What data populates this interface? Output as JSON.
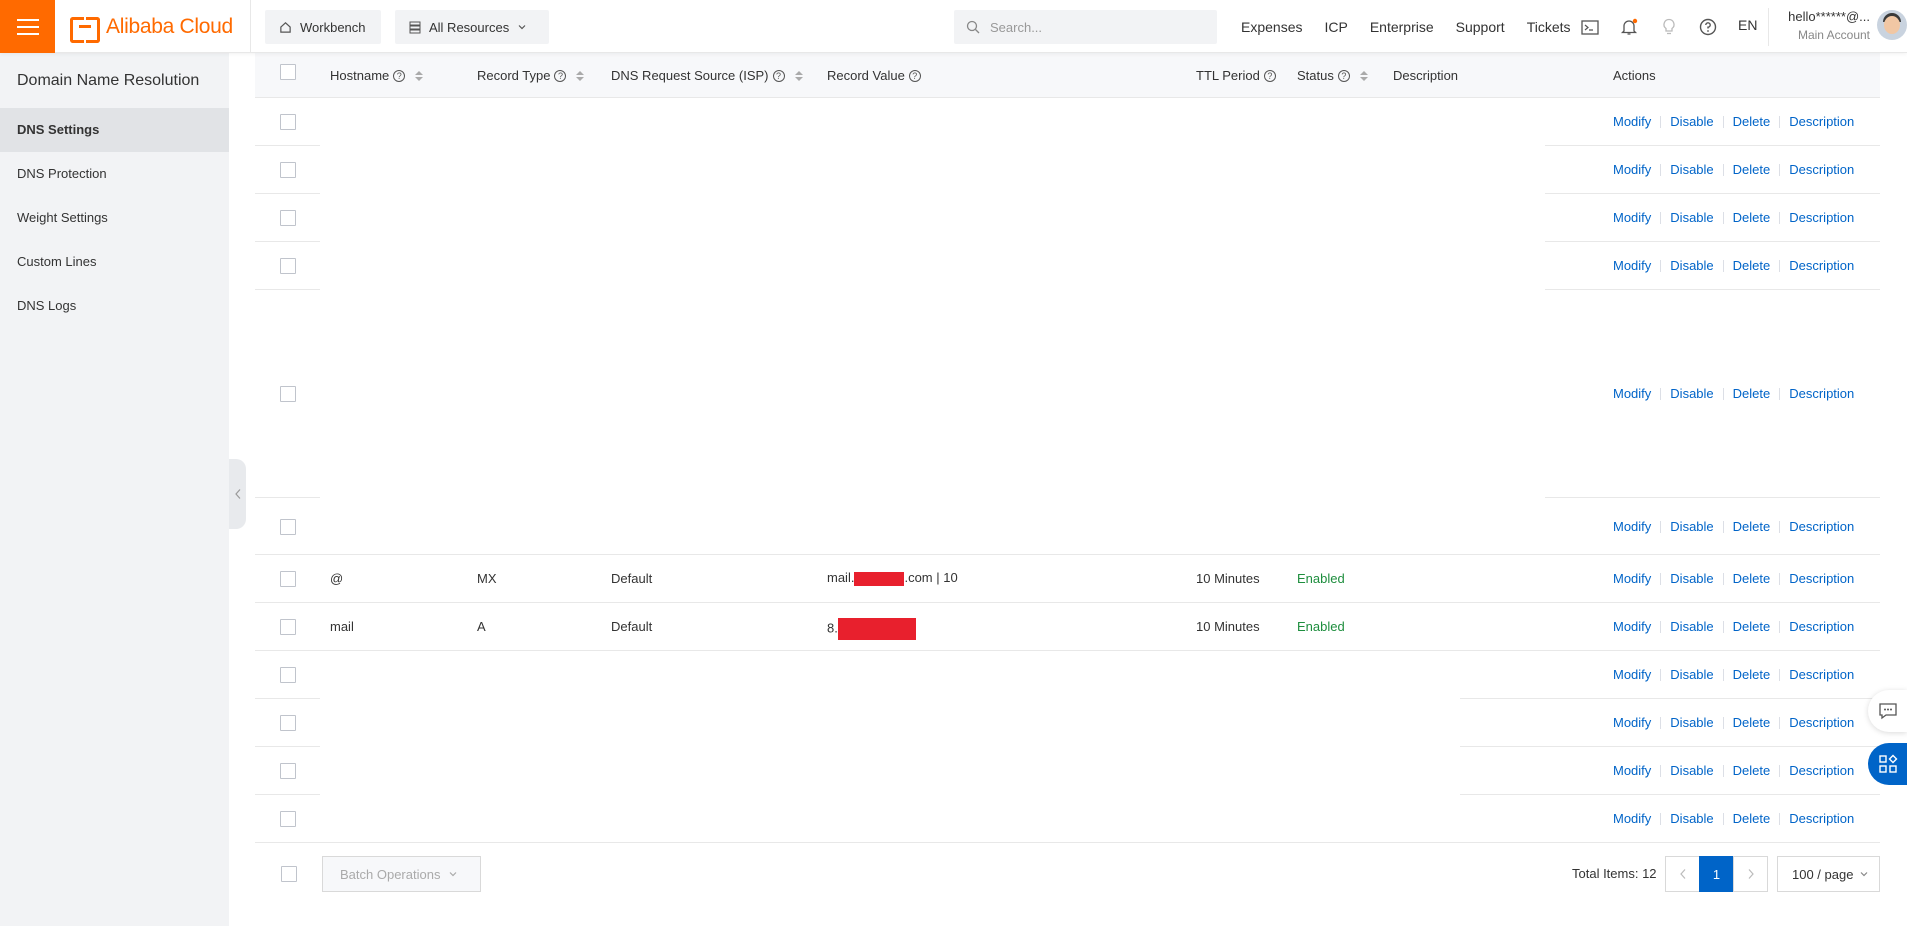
{
  "header": {
    "brand": "Alibaba Cloud",
    "workbench_label": "Workbench",
    "all_resources_label": "All Resources",
    "search_placeholder": "Search...",
    "nav": [
      "Expenses",
      "ICP",
      "Enterprise",
      "Support",
      "Tickets"
    ],
    "lang": "EN",
    "user_name": "hello******@...",
    "user_role": "Main Account",
    "accent_color": "#ff6a00"
  },
  "sidebar": {
    "title": "Domain Name Resolution",
    "items": [
      {
        "label": "DNS Settings",
        "active": true
      },
      {
        "label": "DNS Protection"
      },
      {
        "label": "Weight Settings"
      },
      {
        "label": "Custom Lines"
      },
      {
        "label": "DNS Logs"
      }
    ]
  },
  "table": {
    "columns": {
      "hostname": "Hostname",
      "record_type": "Record Type",
      "isp": "DNS Request Source (ISP)",
      "record_value": "Record Value",
      "ttl": "TTL Period",
      "status": "Status",
      "description": "Description",
      "actions": "Actions"
    },
    "action_labels": {
      "modify": "Modify",
      "disable": "Disable",
      "delete": "Delete",
      "description": "Description"
    },
    "rows": [
      {
        "hostname": "",
        "record_type": "",
        "isp": "",
        "record_value": "",
        "ttl": "",
        "status": ""
      },
      {
        "hostname": "",
        "record_type": "",
        "isp": "",
        "record_value": "",
        "ttl": "",
        "status": ""
      },
      {
        "hostname": "",
        "record_type": "",
        "isp": "",
        "record_value": "",
        "ttl": "",
        "status": ""
      },
      {
        "hostname": "",
        "record_type": "",
        "isp": "",
        "record_value": "",
        "ttl": "",
        "status": ""
      },
      {
        "hostname": "",
        "record_type": "",
        "isp": "",
        "record_value": "",
        "ttl": "",
        "status": ""
      },
      {
        "hostname": "",
        "record_type": "",
        "isp": "",
        "record_value": "",
        "ttl": "",
        "status": ""
      },
      {
        "hostname": "@",
        "record_type": "MX",
        "isp": "Default",
        "record_value_prefix": "mail.",
        "record_value_suffix": ".com | 10",
        "ttl": "10 Minutes",
        "status": "Enabled"
      },
      {
        "hostname": "mail",
        "record_type": "A",
        "isp": "Default",
        "record_value_prefix": "8.",
        "record_value_suffix": "",
        "ttl": "10 Minutes",
        "status": "Enabled"
      },
      {
        "hostname": "",
        "record_type": "",
        "isp": "",
        "record_value": "",
        "ttl": "",
        "status": ""
      },
      {
        "hostname": "",
        "record_type": "",
        "isp": "",
        "record_value": "",
        "ttl": "",
        "status": ""
      },
      {
        "hostname": "",
        "record_type": "",
        "isp": "",
        "record_value": "",
        "ttl": "",
        "status": ""
      },
      {
        "hostname": "",
        "record_type": "",
        "isp": "",
        "record_value": "",
        "ttl": "",
        "status": ""
      }
    ]
  },
  "footer": {
    "batch_label": "Batch Operations",
    "total_label": "Total Items: 12",
    "current_page": "1",
    "page_size": "100 / page"
  },
  "colors": {
    "link": "#0064c8",
    "enabled": "#1e8e3e",
    "redaction": "#e8202d"
  }
}
